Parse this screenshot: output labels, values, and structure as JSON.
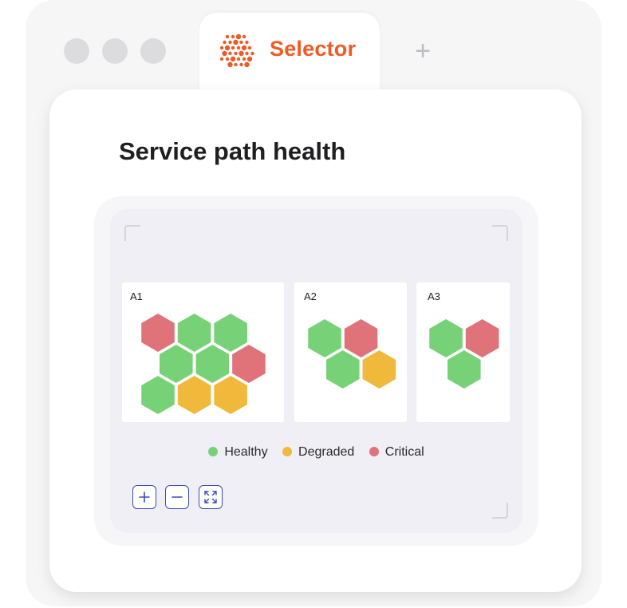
{
  "window": {
    "tab_title": "Selector",
    "logo_icon": "selector-logo-icon",
    "new_tab_icon": "plus-icon",
    "new_tab_glyph": "+"
  },
  "card": {
    "title": "Service path health"
  },
  "colors": {
    "brand": "#f05a24",
    "healthy": "#77d277",
    "degraded": "#f0b93c",
    "critical": "#e0737a",
    "control_border": "#3b4bb5"
  },
  "groups": [
    {
      "label": "A1",
      "cells": [
        {
          "row": 0,
          "col": 0,
          "status": "critical"
        },
        {
          "row": 0,
          "col": 1,
          "status": "healthy"
        },
        {
          "row": 0,
          "col": 2,
          "status": "healthy"
        },
        {
          "row": 1,
          "col": 0,
          "status": "healthy"
        },
        {
          "row": 1,
          "col": 1,
          "status": "healthy"
        },
        {
          "row": 1,
          "col": 2,
          "status": "critical"
        },
        {
          "row": 2,
          "col": 0,
          "status": "healthy"
        },
        {
          "row": 2,
          "col": 1,
          "status": "degraded"
        },
        {
          "row": 2,
          "col": 2,
          "status": "degraded"
        }
      ]
    },
    {
      "label": "A2",
      "cells": [
        {
          "row": 0,
          "col": 0,
          "status": "healthy"
        },
        {
          "row": 0,
          "col": 1,
          "status": "critical"
        },
        {
          "row": 1,
          "col": 0,
          "status": "healthy"
        },
        {
          "row": 1,
          "col": 1,
          "status": "degraded"
        }
      ]
    },
    {
      "label": "A3",
      "cells": [
        {
          "row": 0,
          "col": 0,
          "status": "healthy"
        },
        {
          "row": 0,
          "col": 1,
          "status": "critical"
        },
        {
          "row": 1,
          "col": 0,
          "status": "healthy"
        }
      ]
    }
  ],
  "legend": [
    {
      "key": "healthy",
      "label": "Healthy"
    },
    {
      "key": "degraded",
      "label": "Degraded"
    },
    {
      "key": "critical",
      "label": "Critical"
    }
  ],
  "controls": [
    {
      "name": "zoom-in-button",
      "icon": "plus-icon"
    },
    {
      "name": "zoom-out-button",
      "icon": "minus-icon"
    },
    {
      "name": "fit-to-screen-button",
      "icon": "expand-icon"
    }
  ]
}
